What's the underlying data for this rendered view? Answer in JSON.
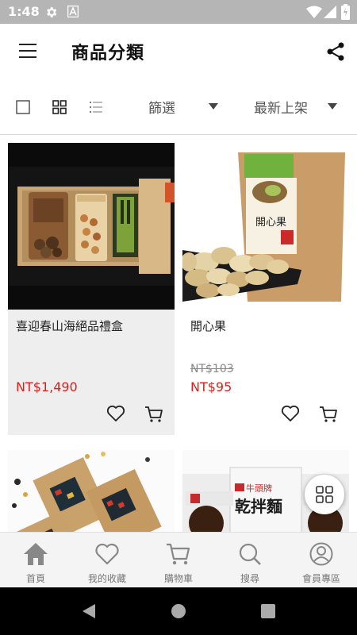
{
  "status_bar": {
    "time": "1:48"
  },
  "app_bar": {
    "title": "商品分類"
  },
  "toolbar": {
    "filter_label": "篩選",
    "sort_label": "最新上架"
  },
  "products": [
    {
      "name": "喜迎春山海絕品禮盒",
      "old_price": "",
      "price": "NT$1,490"
    },
    {
      "name": "開心果",
      "old_price": "NT$103",
      "price": "NT$95"
    },
    {
      "name": "",
      "old_price": "",
      "price": ""
    },
    {
      "name": "",
      "old_price": "",
      "price": ""
    }
  ],
  "product_images": {
    "pistachio_bag_label": "開心果",
    "noodle_bag_label": "乾拌麵",
    "noodle_brand": "牛頭牌"
  },
  "bottom_nav": [
    {
      "label": "首頁",
      "icon": "home-icon"
    },
    {
      "label": "我的收藏",
      "icon": "heart-icon"
    },
    {
      "label": "購物車",
      "icon": "cart-icon"
    },
    {
      "label": "搜尋",
      "icon": "search-icon"
    },
    {
      "label": "會員專區",
      "icon": "account-icon"
    }
  ],
  "colors": {
    "price_red": "#e01e1e",
    "status_bar": "#b5b5b5",
    "nav_bg": "#f4f4f4",
    "nav_icon": "#888888"
  }
}
